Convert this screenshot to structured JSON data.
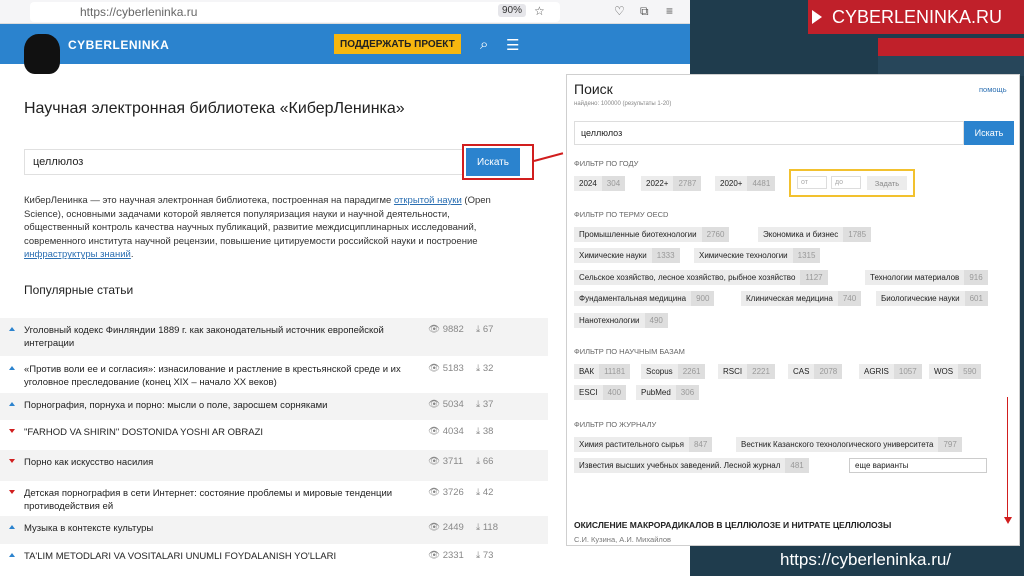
{
  "browser": {
    "url": "https://cyberleninka.ru",
    "zoom": "90%"
  },
  "brand_tag": "CYBERLENINKA.RU",
  "header": {
    "logo_text": "CYBERLENINKA",
    "support": "ПОДДЕРЖАТЬ ПРОЕКТ"
  },
  "main": {
    "title": "Научная электронная библиотека «КиберЛенинка»",
    "search_value": "целлюлоз",
    "search_button": "Искать",
    "about_1": "КиберЛенинка — это научная электронная библиотека, построенная на парадигме ",
    "about_link1": "открытой науки",
    "about_2": " (Open Science), основными задачами которой является популяризация науки и научной деятельности, общественный контроль качества научных публикаций, развитие междисциплинарных исследований, современного института научной рецензии, повышение цитируемости российской науки и построение ",
    "about_link2": "инфраструктуры знаний",
    "about_3": ".",
    "popular_title": "Популярные статьи",
    "articles": [
      {
        "title": "Уголовный кодекс Финляндии 1889 г. как законодательный источник европейской интеграции",
        "views": "9882",
        "downloads": "67",
        "dir": "up"
      },
      {
        "title": "«Против воли ее и согласия»: изнасилование и растление в крестьянской среде и их уголовное преследование (конец XIX – начало XX веков)",
        "views": "5183",
        "downloads": "32",
        "dir": "up"
      },
      {
        "title": "Порнография, порнуха и порно: мысли о поле, заросшем сорняками",
        "views": "5034",
        "downloads": "37",
        "dir": "up"
      },
      {
        "title": "\"FARHOD VA SHIRIN\" DOSTONIDA YOSHI AR OBRAZI",
        "views": "4034",
        "downloads": "38",
        "dir": "down"
      },
      {
        "title": "Порно как искусство насилия",
        "views": "3711",
        "downloads": "66",
        "dir": "down"
      },
      {
        "title": "Детская порнография в сети Интернет: состояние проблемы и мировые тенденции противодействия ей",
        "views": "3726",
        "downloads": "42",
        "dir": "down"
      },
      {
        "title": "Музыка в контексте культуры",
        "views": "2449",
        "downloads": "118",
        "dir": "up"
      },
      {
        "title": "TA'LIM METODLARI VA VOSITALARI UNUMLI FOYDALANISH YO'LLARI",
        "views": "2331",
        "downloads": "73",
        "dir": "up"
      }
    ]
  },
  "panel": {
    "title": "Поиск",
    "help": "помощь",
    "subtitle": "найдено: 100000 (результаты 1-20)",
    "query": "целлюлоз",
    "button": "Искать",
    "year_section": "ФИЛЬТР ПО ГОДУ",
    "years": [
      {
        "label": "2024",
        "count": "304"
      },
      {
        "label": "2022+",
        "count": "2787"
      },
      {
        "label": "2020+",
        "count": "4481"
      }
    ],
    "year_from": "от",
    "year_to": "до",
    "year_apply": "Задать",
    "oecd_section": "ФИЛЬТР ПО ТЕРМУ OECD",
    "oecd": [
      {
        "label": "Промышленные биотехнологии",
        "count": "2760"
      },
      {
        "label": "Экономика и бизнес",
        "count": "1785"
      },
      {
        "label": "Химические науки",
        "count": "1333"
      },
      {
        "label": "Химические технологии",
        "count": "1315"
      },
      {
        "label": "Сельское хозяйство, лесное хозяйство, рыбное хозяйство",
        "count": "1127"
      },
      {
        "label": "Технологии материалов",
        "count": "916"
      },
      {
        "label": "Фундаментальная медицина",
        "count": "900"
      },
      {
        "label": "Клиническая медицина",
        "count": "740"
      },
      {
        "label": "Биологические науки",
        "count": "601"
      },
      {
        "label": "Нанотехнологии",
        "count": "490"
      }
    ],
    "bases_section": "ФИЛЬТР ПО НАУЧНЫМ БАЗАМ",
    "bases": [
      {
        "label": "ВАК",
        "count": "11181"
      },
      {
        "label": "Scopus",
        "count": "2261"
      },
      {
        "label": "RSCI",
        "count": "2221"
      },
      {
        "label": "CAS",
        "count": "2078"
      },
      {
        "label": "AGRIS",
        "count": "1057"
      },
      {
        "label": "WOS",
        "count": "590"
      },
      {
        "label": "ESCI",
        "count": "400"
      },
      {
        "label": "PubMed",
        "count": "306"
      }
    ],
    "journal_section": "ФИЛЬТР ПО ЖУРНАЛУ",
    "journals": [
      {
        "label": "Химия растительного сырья",
        "count": "847"
      },
      {
        "label": "Вестник Казанского технологического университета",
        "count": "797"
      },
      {
        "label": "Известия высших учебных заведений. Лесной журнал",
        "count": "481"
      }
    ],
    "more": "еще варианты",
    "result_title": "ОКИСЛЕНИЕ МАКРОРАДИКАЛОВ В ЦЕЛЛЮЛОЗЕ И НИТРАТЕ ЦЕЛЛЮЛОЗЫ",
    "result_authors": "С.И. Кузина, А.И. Михайлов"
  },
  "footer_url": "https://cyberleninka.ru/"
}
